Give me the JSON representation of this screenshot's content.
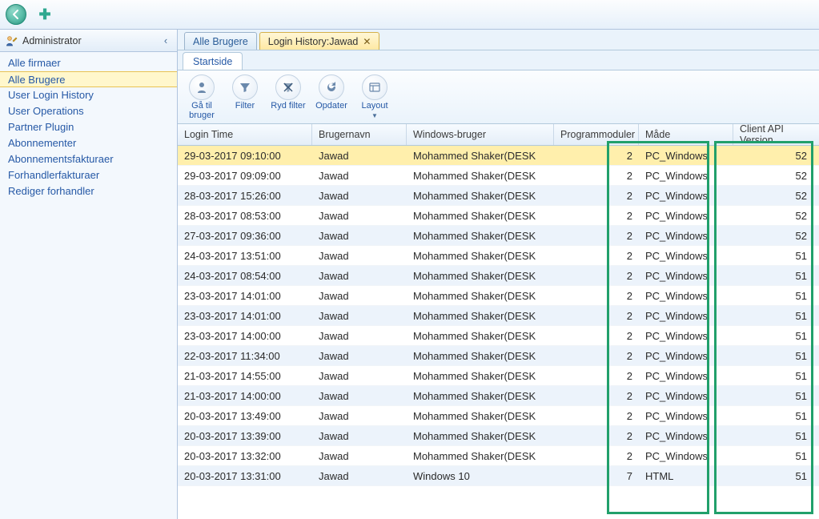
{
  "topToolbar": {
    "backIcon": "back-icon",
    "addIcon": "plus-icon"
  },
  "sidebar": {
    "title": "Administrator",
    "collapseGlyph": "‹",
    "items": [
      {
        "label": "Alle firmaer"
      },
      {
        "label": "Alle Brugere",
        "selected": true
      },
      {
        "label": "User Login History"
      },
      {
        "label": "User Operations"
      },
      {
        "label": "Partner Plugin"
      },
      {
        "label": "Abonnementer"
      },
      {
        "label": "Abonnementsfakturaer"
      },
      {
        "label": "Forhandlerfakturaer"
      },
      {
        "label": "Rediger forhandler"
      }
    ]
  },
  "contentTabs": [
    {
      "label": "Alle Brugere",
      "closable": false,
      "active": false
    },
    {
      "label": "Login History:Jawad",
      "closable": true,
      "active": true
    }
  ],
  "ribbon": {
    "tabLabel": "Startside",
    "buttons": [
      {
        "key": "go-to-user",
        "label": "Gå til bruger",
        "icon": "person-icon"
      },
      {
        "key": "filter",
        "label": "Filter",
        "icon": "funnel-icon"
      },
      {
        "key": "clear-filter",
        "label": "Ryd filter",
        "icon": "clear-funnel-icon"
      },
      {
        "key": "refresh",
        "label": "Opdater",
        "icon": "refresh-icon"
      },
      {
        "key": "layout",
        "label": "Layout",
        "icon": "layout-icon",
        "dropdown": true
      }
    ]
  },
  "grid": {
    "columns": {
      "login_time": "Login Time",
      "brugernavn": "Brugernavn",
      "windows_bruger": "Windows-bruger",
      "programmoduler": "Programmoduler",
      "maade": "Måde",
      "client_api": "Client API Version"
    },
    "rows": [
      {
        "login_time": "29-03-2017 09:10:00",
        "brugernavn": "Jawad",
        "windows_bruger": "Mohammed Shaker(DESK",
        "programmoduler": "2",
        "maade": "PC_Windows",
        "client_api": "52",
        "selected": true
      },
      {
        "login_time": "29-03-2017 09:09:00",
        "brugernavn": "Jawad",
        "windows_bruger": "Mohammed Shaker(DESK",
        "programmoduler": "2",
        "maade": "PC_Windows",
        "client_api": "52"
      },
      {
        "login_time": "28-03-2017 15:26:00",
        "brugernavn": "Jawad",
        "windows_bruger": "Mohammed Shaker(DESK",
        "programmoduler": "2",
        "maade": "PC_Windows",
        "client_api": "52"
      },
      {
        "login_time": "28-03-2017 08:53:00",
        "brugernavn": "Jawad",
        "windows_bruger": "Mohammed Shaker(DESK",
        "programmoduler": "2",
        "maade": "PC_Windows",
        "client_api": "52"
      },
      {
        "login_time": "27-03-2017 09:36:00",
        "brugernavn": "Jawad",
        "windows_bruger": "Mohammed Shaker(DESK",
        "programmoduler": "2",
        "maade": "PC_Windows",
        "client_api": "52"
      },
      {
        "login_time": "24-03-2017 13:51:00",
        "brugernavn": "Jawad",
        "windows_bruger": "Mohammed Shaker(DESK",
        "programmoduler": "2",
        "maade": "PC_Windows",
        "client_api": "51"
      },
      {
        "login_time": "24-03-2017 08:54:00",
        "brugernavn": "Jawad",
        "windows_bruger": "Mohammed Shaker(DESK",
        "programmoduler": "2",
        "maade": "PC_Windows",
        "client_api": "51"
      },
      {
        "login_time": "23-03-2017 14:01:00",
        "brugernavn": "Jawad",
        "windows_bruger": "Mohammed Shaker(DESK",
        "programmoduler": "2",
        "maade": "PC_Windows",
        "client_api": "51"
      },
      {
        "login_time": "23-03-2017 14:01:00",
        "brugernavn": "Jawad",
        "windows_bruger": "Mohammed Shaker(DESK",
        "programmoduler": "2",
        "maade": "PC_Windows",
        "client_api": "51"
      },
      {
        "login_time": "23-03-2017 14:00:00",
        "brugernavn": "Jawad",
        "windows_bruger": "Mohammed Shaker(DESK",
        "programmoduler": "2",
        "maade": "PC_Windows",
        "client_api": "51"
      },
      {
        "login_time": "22-03-2017 11:34:00",
        "brugernavn": "Jawad",
        "windows_bruger": "Mohammed Shaker(DESK",
        "programmoduler": "2",
        "maade": "PC_Windows",
        "client_api": "51"
      },
      {
        "login_time": "21-03-2017 14:55:00",
        "brugernavn": "Jawad",
        "windows_bruger": "Mohammed Shaker(DESK",
        "programmoduler": "2",
        "maade": "PC_Windows",
        "client_api": "51"
      },
      {
        "login_time": "21-03-2017 14:00:00",
        "brugernavn": "Jawad",
        "windows_bruger": "Mohammed Shaker(DESK",
        "programmoduler": "2",
        "maade": "PC_Windows",
        "client_api": "51"
      },
      {
        "login_time": "20-03-2017 13:49:00",
        "brugernavn": "Jawad",
        "windows_bruger": "Mohammed Shaker(DESK",
        "programmoduler": "2",
        "maade": "PC_Windows",
        "client_api": "51"
      },
      {
        "login_time": "20-03-2017 13:39:00",
        "brugernavn": "Jawad",
        "windows_bruger": "Mohammed Shaker(DESK",
        "programmoduler": "2",
        "maade": "PC_Windows",
        "client_api": "51"
      },
      {
        "login_time": "20-03-2017 13:32:00",
        "brugernavn": "Jawad",
        "windows_bruger": "Mohammed Shaker(DESK",
        "programmoduler": "2",
        "maade": "PC_Windows",
        "client_api": "51"
      },
      {
        "login_time": "20-03-2017 13:31:00",
        "brugernavn": "Jawad",
        "windows_bruger": "Windows 10",
        "programmoduler": "7",
        "maade": "HTML",
        "client_api": "51"
      }
    ]
  }
}
